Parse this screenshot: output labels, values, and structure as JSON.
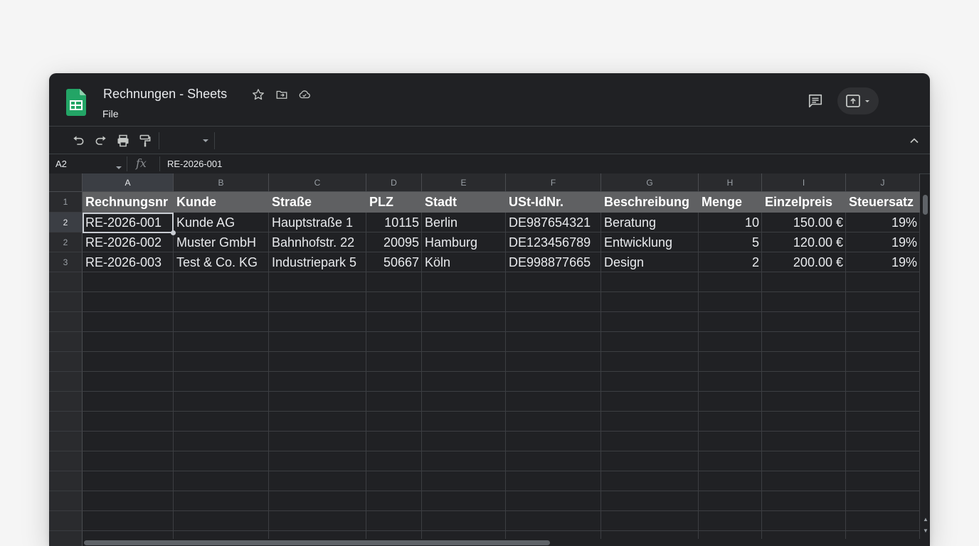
{
  "app": {
    "doc_title": "Rechnungen - Sheets",
    "menu": {
      "file": "File"
    }
  },
  "icons": {
    "logo": "sheets-logo-icon",
    "star": "star-icon",
    "move": "folder-move-icon",
    "cloud": "cloud-status-icon",
    "comments": "comment-history-icon",
    "present": "present-icon",
    "undo": "undo-icon",
    "redo": "redo-icon",
    "print": "print-icon",
    "paint_format": "paint-format-icon",
    "collapse": "chevron-up-icon"
  },
  "colors": {
    "sheets_green": "#23a566",
    "header_band": "#5f6062"
  },
  "formula_bar": {
    "cell_ref": "A2",
    "value": "RE-2026-001"
  },
  "sheet": {
    "columns": [
      "A",
      "B",
      "C",
      "D",
      "E",
      "F",
      "G",
      "H",
      "I",
      "J"
    ],
    "row_numbers": [
      "1",
      "2",
      "2",
      "3"
    ],
    "header_row": [
      "Rechnungsnr",
      "Kunde",
      "Straße",
      "PLZ",
      "Stadt",
      "USt-IdNr.",
      "Beschreibung",
      "Menge",
      "Einzelpreis",
      "Steuersatz"
    ],
    "rows": [
      [
        "RE-2026-001",
        "Kunde AG",
        "Hauptstraße 1",
        "10115",
        "Berlin",
        "DE987654321",
        "Beratung",
        "10",
        "150.00 €",
        "19%"
      ],
      [
        "RE-2026-002",
        "Muster GmbH",
        "Bahnhofstr. 22",
        "20095",
        "Hamburg",
        "DE123456789",
        "Entwicklung",
        "5",
        "120.00 €",
        "19%"
      ],
      [
        "RE-2026-003",
        "Test & Co. KG",
        "Industriepark 5",
        "50667",
        "Köln",
        "DE998877665",
        "Design",
        "2",
        "200.00 €",
        "19%"
      ]
    ],
    "right_aligned_columns": [
      3,
      7,
      8,
      9
    ],
    "active_cell": {
      "row": 2,
      "col": 0
    }
  }
}
